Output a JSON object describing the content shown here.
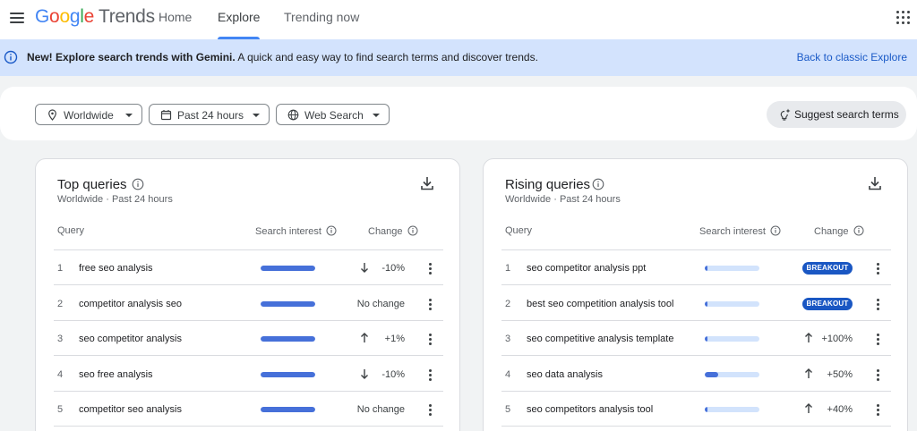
{
  "header": {
    "logo_letters": [
      "G",
      "o",
      "o",
      "g",
      "l",
      "e"
    ],
    "logo_suffix": "Trends",
    "tabs": [
      {
        "label": "Home"
      },
      {
        "label": "Explore"
      },
      {
        "label": "Trending now"
      }
    ],
    "active_tab": "Explore",
    "icons": {
      "menu": "hamburger-menu-icon",
      "apps": "apps-grid-icon"
    }
  },
  "banner": {
    "bold": "New! Explore search trends with Gemini.",
    "text": " A quick and easy way to find search terms and discover trends.",
    "link": "Back to classic Explore",
    "icon": "info-icon",
    "background": "#d3e3fd",
    "link_color": "#1a5ac7"
  },
  "filters": {
    "location": {
      "label": "Worldwide",
      "icon": "location-pin-icon"
    },
    "time": {
      "label": "Past 24 hours",
      "icon": "calendar-icon"
    },
    "source": {
      "label": "Web Search",
      "icon": "globe-icon"
    },
    "suggest": {
      "label": "Suggest search terms",
      "icon": "sparkle-bulb-icon"
    }
  },
  "top_queries": {
    "title": "Top queries",
    "subtitle_location": "Worldwide",
    "subtitle_sep": "·",
    "subtitle_time": "Past 24 hours",
    "columns": {
      "query": "Query",
      "interest": "Search interest",
      "change": "Change"
    },
    "rows": [
      {
        "rank": "1",
        "term": "free seo analysis",
        "interest": 100,
        "direction": "down",
        "change": "-10%"
      },
      {
        "rank": "2",
        "term": "competitor analysis seo",
        "interest": 100,
        "direction": "none",
        "change": "No change"
      },
      {
        "rank": "3",
        "term": "seo competitor analysis",
        "interest": 100,
        "direction": "up",
        "change": "+1%"
      },
      {
        "rank": "4",
        "term": "seo free analysis",
        "interest": 100,
        "direction": "down",
        "change": "-10%"
      },
      {
        "rank": "5",
        "term": "competitor seo analysis",
        "interest": 100,
        "direction": "none",
        "change": "No change"
      }
    ]
  },
  "rising_queries": {
    "title": "Rising queries",
    "subtitle_location": "Worldwide",
    "subtitle_sep": "·",
    "subtitle_time": "Past 24 hours",
    "columns": {
      "query": "Query",
      "interest": "Search interest",
      "change": "Change"
    },
    "rows": [
      {
        "rank": "1",
        "term": "seo competitor analysis ppt",
        "interest": 3,
        "direction": "breakout",
        "change": "BREAKOUT"
      },
      {
        "rank": "2",
        "term": "best seo competition analysis tool",
        "interest": 3,
        "direction": "breakout",
        "change": "BREAKOUT"
      },
      {
        "rank": "3",
        "term": "seo competitive analysis template",
        "interest": 3,
        "direction": "up",
        "change": "+100%"
      },
      {
        "rank": "4",
        "term": "seo data analysis",
        "interest": 25,
        "direction": "up",
        "change": "+50%"
      },
      {
        "rank": "5",
        "term": "seo competitors analysis tool",
        "interest": 5,
        "direction": "up",
        "change": "+40%"
      }
    ]
  },
  "colors": {
    "bar_fill": "#4670d9",
    "bar_track": "#d2e3fc",
    "breakout": "#1a57c3",
    "accent": "#4285f4"
  }
}
